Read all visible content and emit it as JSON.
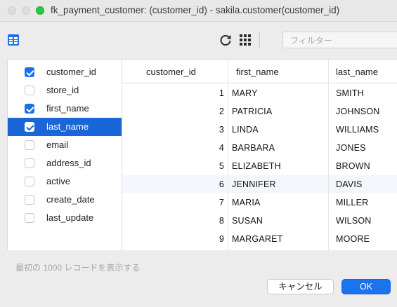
{
  "window": {
    "title": "fk_payment_customer: (customer_id) - sakila.customer(customer_id)"
  },
  "toolbar": {
    "columns_icon": "columns-icon",
    "refresh_icon": "refresh-icon",
    "grid_icon": "grid-icon",
    "filter_placeholder": "フィルター"
  },
  "column_list": [
    {
      "label": "customer_id",
      "checked": true,
      "selected": false
    },
    {
      "label": "store_id",
      "checked": false,
      "selected": false
    },
    {
      "label": "first_name",
      "checked": true,
      "selected": false
    },
    {
      "label": "last_name",
      "checked": true,
      "selected": true
    },
    {
      "label": "email",
      "checked": false,
      "selected": false
    },
    {
      "label": "address_id",
      "checked": false,
      "selected": false
    },
    {
      "label": "active",
      "checked": false,
      "selected": false
    },
    {
      "label": "create_date",
      "checked": false,
      "selected": false
    },
    {
      "label": "last_update",
      "checked": false,
      "selected": false
    }
  ],
  "table": {
    "headers": [
      "customer_id",
      "first_name",
      "last_name"
    ],
    "rows": [
      [
        "1",
        "MARY",
        "SMITH"
      ],
      [
        "2",
        "PATRICIA",
        "JOHNSON"
      ],
      [
        "3",
        "LINDA",
        "WILLIAMS"
      ],
      [
        "4",
        "BARBARA",
        "JONES"
      ],
      [
        "5",
        "ELIZABETH",
        "BROWN"
      ],
      [
        "6",
        "JENNIFER",
        "DAVIS"
      ],
      [
        "7",
        "MARIA",
        "MILLER"
      ],
      [
        "8",
        "SUSAN",
        "WILSON"
      ],
      [
        "9",
        "MARGARET",
        "MOORE"
      ]
    ]
  },
  "footer": {
    "info": "最初の 1000 レコードを表示する",
    "cancel_label": "キャンセル",
    "ok_label": "OK"
  },
  "colors": {
    "accent": "#1b73ee",
    "selection": "#1a65d8",
    "traffic_green": "#2ac840"
  }
}
